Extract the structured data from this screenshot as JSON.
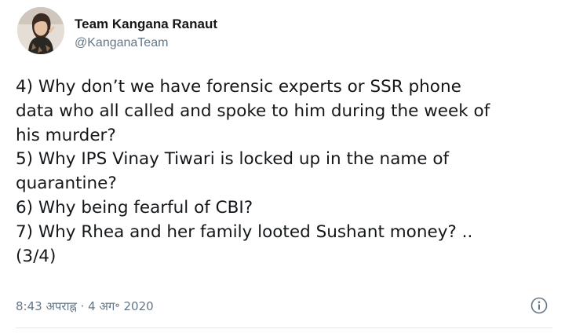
{
  "author": {
    "display_name": "Team Kangana Ranaut",
    "handle": "@KanganaTeam",
    "avatar_icon": "profile-photo"
  },
  "tweet": {
    "lines": [
      "4) Why don’t we have forensic experts or SSR phone",
      "data who all called and spoke to him during the week of",
      "his murder?",
      "5) Why IPS Vinay Tiwari is locked up in the name of",
      "quarantine?",
      "6) Why being fearful of CBI?",
      "7) Why Rhea and her family looted Sushant money? ..",
      "(3/4)"
    ]
  },
  "meta": {
    "time": "8:43 अपराह्न",
    "separator": "·",
    "date": "4 अग॰ 2020"
  },
  "icons": {
    "info": "info-icon"
  },
  "colors": {
    "text": "#14171a",
    "secondary": "#657786",
    "divider": "#e1e8ed"
  }
}
